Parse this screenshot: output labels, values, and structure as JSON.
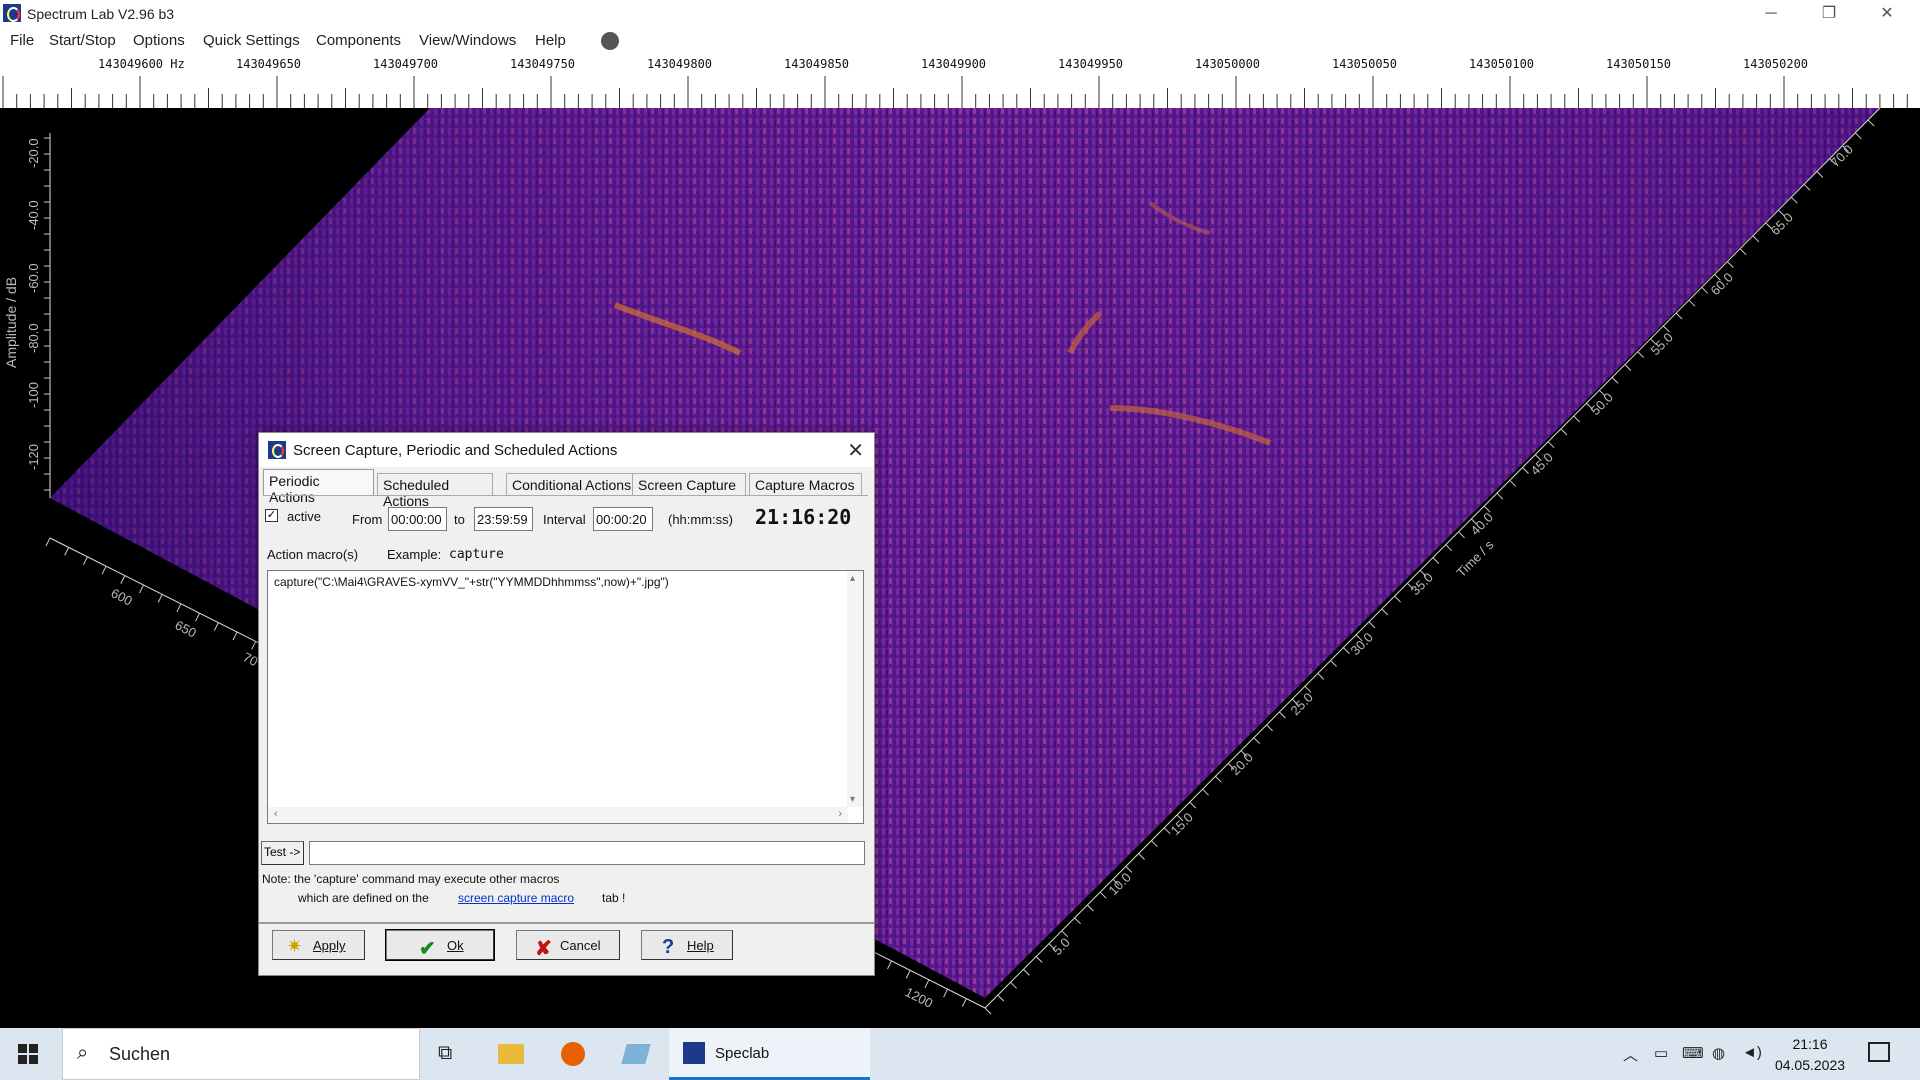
{
  "window": {
    "title": "Spectrum Lab V2.96 b3",
    "controls": {
      "minimize": "─",
      "restore": "❐",
      "close": "✕"
    }
  },
  "menu": [
    "File",
    "Start/Stop",
    "Options",
    "Quick Settings",
    "Components",
    "View/Windows",
    "Help"
  ],
  "frequency_axis": {
    "labels": [
      "143049600 Hz",
      "143049650",
      "143049700",
      "143049750",
      "143049800",
      "143049850",
      "143049900",
      "143049950",
      "143050000",
      "143050050",
      "143050100",
      "143050150",
      "143050200"
    ]
  },
  "plot": {
    "amplitude_label": "Amplitude / dB",
    "amplitude_ticks": [
      "-20.0",
      "-40.0",
      "-60.0",
      "-80.0",
      "-100",
      "-120"
    ],
    "bin_ticks": [
      "600",
      "650",
      "70",
      "1200"
    ],
    "time_label": "Time / s",
    "time_ticks": [
      "5.0",
      "10.0",
      "15.0",
      "20.0",
      "25.0",
      "30.0",
      "35.0",
      "40.0",
      "45.0",
      "50.0",
      "55.0",
      "60.0",
      "65.0",
      "70.0"
    ],
    "colors": {
      "low": "#3a0c6e",
      "mid": "#7a1f9a",
      "high": "#c0407e",
      "peak": "#e07a3a"
    }
  },
  "dialog": {
    "title": "Screen Capture, Periodic and Scheduled Actions",
    "tabs": [
      "Periodic Actions",
      "Scheduled Actions",
      "Conditional Actions",
      "Screen Capture",
      "Capture Macros"
    ],
    "active_label": "active",
    "active_checked": true,
    "from_label": "From",
    "from_value": "00:00:00",
    "to_label": "to",
    "to_value": "23:59:59",
    "interval_label": "Interval",
    "interval_value": "00:00:20",
    "format_hint": "(hh:mm:ss)",
    "clock": "21:16:20",
    "macro_label": "Action macro(s)",
    "example_label": "Example:",
    "example_value": "capture",
    "macro_text": "capture(\"C:\\Mai4\\GRAVES-xymVV_\"+str(\"YYMMDDhhmmss\",now)+\".jpg\")",
    "test_button": "Test ->",
    "test_value": "",
    "note_line1": "Note: the 'capture' command  may  execute other macros",
    "note_line2_pre": "which are defined on the",
    "note_link": "screen capture macro",
    "note_line2_post": "tab !",
    "buttons": {
      "apply": "Apply",
      "ok": "Ok",
      "cancel": "Cancel",
      "help": "Help"
    }
  },
  "taskbar": {
    "search_placeholder": "Suchen",
    "active_app": "Speclab",
    "time": "21:16",
    "date": "04.05.2023"
  }
}
